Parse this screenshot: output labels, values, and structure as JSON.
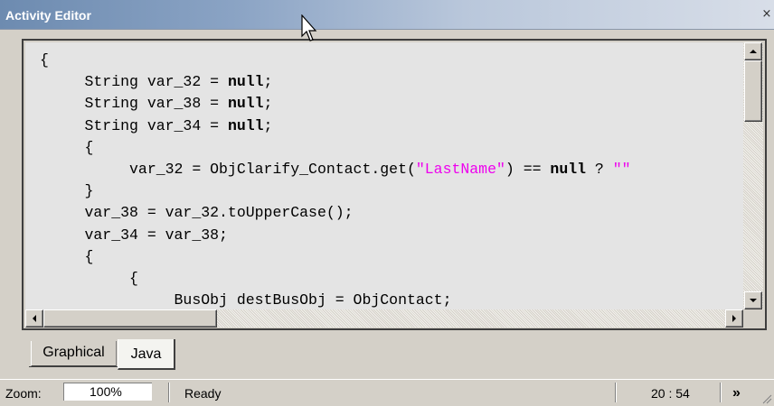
{
  "window": {
    "title": "Activity Editor",
    "close_glyph": "×"
  },
  "code": [
    {
      "segments": [
        {
          "t": "{",
          "c": "plain"
        }
      ]
    },
    {
      "segments": [
        {
          "t": "     String var_32 = ",
          "c": "plain"
        },
        {
          "t": "null",
          "c": "kw"
        },
        {
          "t": ";",
          "c": "plain"
        }
      ]
    },
    {
      "segments": [
        {
          "t": "     String var_38 = ",
          "c": "plain"
        },
        {
          "t": "null",
          "c": "kw"
        },
        {
          "t": ";",
          "c": "plain"
        }
      ]
    },
    {
      "segments": [
        {
          "t": "     String var_34 = ",
          "c": "plain"
        },
        {
          "t": "null",
          "c": "kw"
        },
        {
          "t": ";",
          "c": "plain"
        }
      ]
    },
    {
      "segments": [
        {
          "t": "     {",
          "c": "plain"
        }
      ]
    },
    {
      "segments": [
        {
          "t": "          var_32 = ObjClarify_Contact.get(",
          "c": "plain"
        },
        {
          "t": "\"LastName\"",
          "c": "str"
        },
        {
          "t": ") == ",
          "c": "plain"
        },
        {
          "t": "null",
          "c": "kw"
        },
        {
          "t": " ? ",
          "c": "plain"
        },
        {
          "t": "\"\"",
          "c": "str"
        }
      ]
    },
    {
      "segments": [
        {
          "t": "     }",
          "c": "plain"
        }
      ]
    },
    {
      "segments": [
        {
          "t": "     var_38 = var_32.toUpperCase();",
          "c": "plain"
        }
      ]
    },
    {
      "segments": [
        {
          "t": "     var_34 = var_38;",
          "c": "plain"
        }
      ]
    },
    {
      "segments": [
        {
          "t": "     {",
          "c": "plain"
        }
      ]
    },
    {
      "segments": [
        {
          "t": "          {",
          "c": "plain"
        }
      ]
    },
    {
      "segments": [
        {
          "t": "               BusObj destBusObj = ObjContact;",
          "c": "plain"
        }
      ]
    }
  ],
  "tabs": [
    {
      "label": "Graphical",
      "active": false
    },
    {
      "label": "Java",
      "active": true
    }
  ],
  "status": {
    "zoom_label": "Zoom:",
    "zoom_value": "100%",
    "state": "Ready",
    "position": "20 : 54",
    "more_glyph": "»"
  },
  "scroll": {
    "vertical_position": 0.0,
    "horizontal_position": 0.0
  },
  "colors": {
    "keyword": "#000000",
    "string": "#ee00ee",
    "editor_bg": "#e4e4e4",
    "window_bg": "#d4d0c8"
  }
}
